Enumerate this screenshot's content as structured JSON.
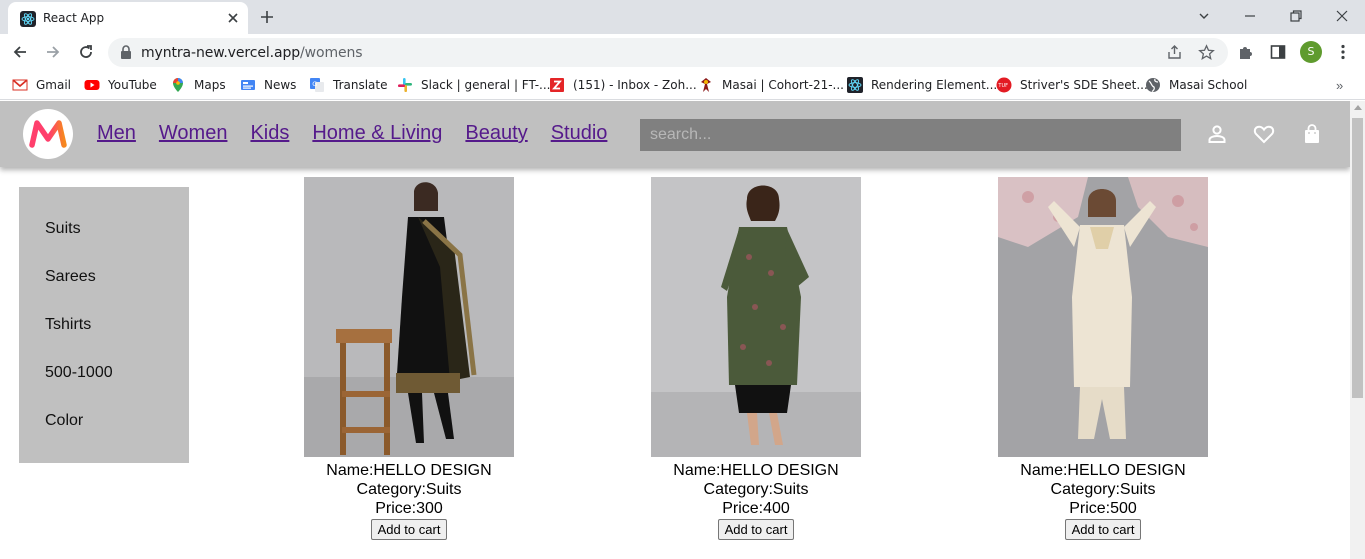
{
  "browser": {
    "tab_title": "React App",
    "url_host": "myntra-new.vercel.app",
    "url_path": "/womens",
    "profile_initial": "S",
    "bookmarks": [
      {
        "label": "Gmail",
        "icon": "gmail-icon"
      },
      {
        "label": "YouTube",
        "icon": "youtube-icon"
      },
      {
        "label": "Maps",
        "icon": "maps-icon"
      },
      {
        "label": "News",
        "icon": "news-icon"
      },
      {
        "label": "Translate",
        "icon": "translate-icon"
      },
      {
        "label": "Slack | general | FT-...",
        "icon": "slack-icon"
      },
      {
        "label": "(151) - Inbox - Zoh...",
        "icon": "zoho-icon"
      },
      {
        "label": "Masai | Cohort-21-...",
        "icon": "masai-icon"
      },
      {
        "label": "Rendering Element...",
        "icon": "react-icon"
      },
      {
        "label": "Striver's SDE Sheet...",
        "icon": "tuf-icon"
      },
      {
        "label": "Masai School",
        "icon": "globe-icon"
      }
    ]
  },
  "site": {
    "nav_links": [
      "Men",
      "Women",
      "Kids",
      "Home & Living",
      "Beauty",
      "Studio"
    ],
    "search_placeholder": "search..."
  },
  "sidebar": {
    "items": [
      "Suits",
      "Sarees",
      "Tshirts",
      "500-1000",
      "Color"
    ]
  },
  "products": [
    {
      "name": "Name:HELLO DESIGN",
      "category": "Category:Suits",
      "price": "Price:300",
      "button": "Add to cart",
      "image_desc": "black-kurta-dupatta"
    },
    {
      "name": "Name:HELLO DESIGN",
      "category": "Category:Suits",
      "price": "Price:400",
      "button": "Add to cart",
      "image_desc": "green-printed-kurta"
    },
    {
      "name": "Name:HELLO DESIGN",
      "category": "Category:Suits",
      "price": "Price:500",
      "button": "Add to cart",
      "image_desc": "cream-kurta-set"
    }
  ],
  "colors": {
    "nav_bg": "#c0c0c0",
    "link": "#551a8b",
    "search_bg": "#808080",
    "logo_pink": "#ff3f6c",
    "logo_orange": "#f6881f"
  }
}
